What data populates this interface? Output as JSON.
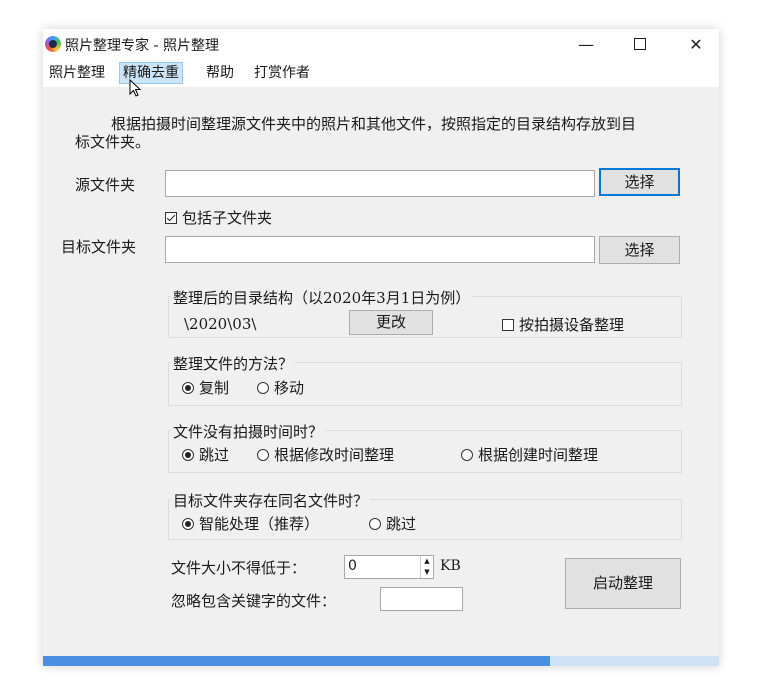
{
  "window": {
    "title": "照片整理专家 - 照片整理",
    "controls": {
      "minimize": "—",
      "close": "✕"
    }
  },
  "menu": [
    "照片整理",
    "精确去重",
    "帮助",
    "打赏作者"
  ],
  "description": "根据拍摄时间整理源文件夹中的照片和其他文件，按照指定的目录结构存放到目标文件夹。",
  "source": {
    "label": "源文件夹",
    "value": "",
    "button": "选择"
  },
  "include_subfolders": {
    "label": "包括子文件夹",
    "checked": true
  },
  "target": {
    "label": "目标文件夹",
    "value": "",
    "button": "选择"
  },
  "structure": {
    "title": "整理后的目录结构（以2020年3月1日为例）",
    "example": "\\2020\\03\\",
    "change_button": "更改",
    "by_device": {
      "label": "按拍摄设备整理",
      "checked": false
    }
  },
  "method": {
    "title": "整理文件的方法？",
    "options": [
      {
        "label": "复制",
        "selected": true
      },
      {
        "label": "移动",
        "selected": false
      }
    ]
  },
  "no_time": {
    "title": "文件没有拍摄时间时？",
    "options": [
      {
        "label": "跳过",
        "selected": true
      },
      {
        "label": "根据修改时间整理",
        "selected": false
      },
      {
        "label": "根据创建时间整理",
        "selected": false
      }
    ]
  },
  "duplicate": {
    "title": "目标文件夹存在同名文件时？",
    "options": [
      {
        "label": "智能处理（推荐）",
        "selected": true
      },
      {
        "label": "跳过",
        "selected": false
      }
    ]
  },
  "min_size": {
    "label": "文件大小不得低于：",
    "value": "0",
    "unit": "KB"
  },
  "ignore_keyword": {
    "label": "忽略包含关键字的文件：",
    "value": ""
  },
  "start_button": "启动整理",
  "progress": 0.75,
  "colors": {
    "accent": "#0078d7",
    "progress": "#4a90e2",
    "progress_track": "#cfe1f6"
  }
}
